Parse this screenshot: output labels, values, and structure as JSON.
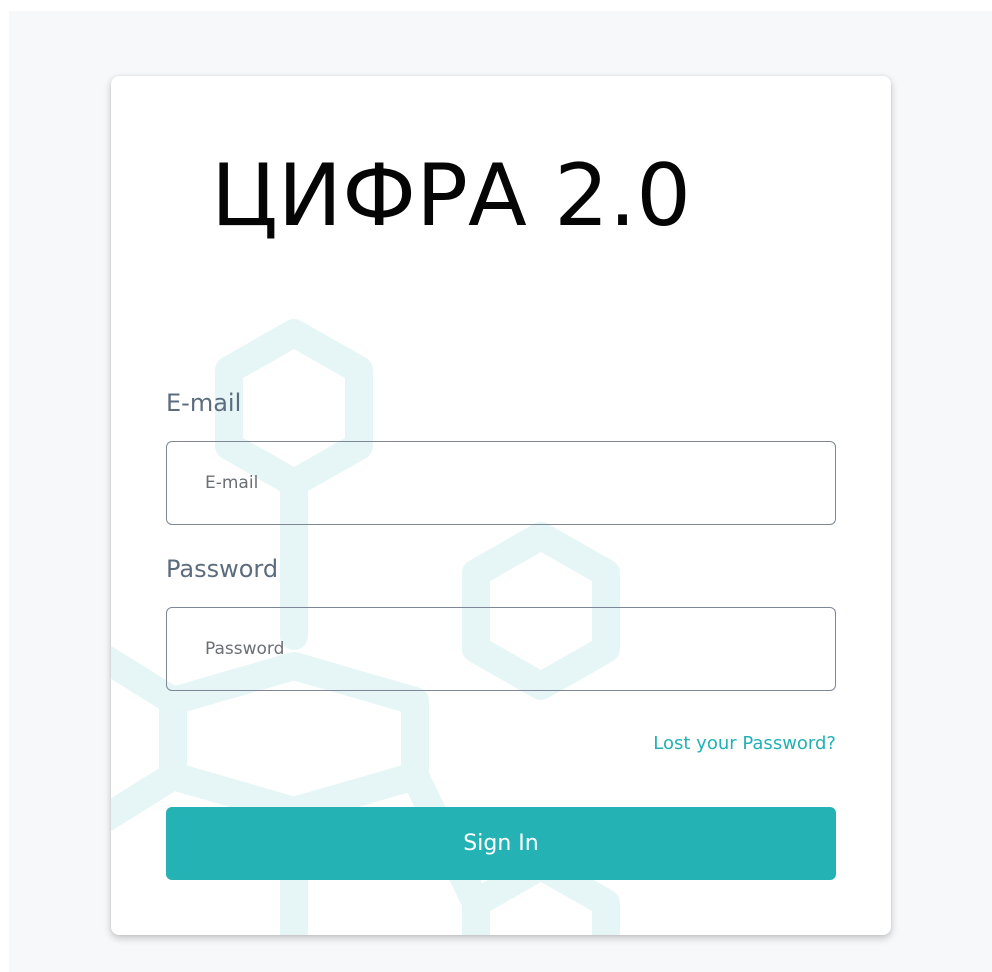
{
  "brand": {
    "logo_text": "ЦИФРА 2.0"
  },
  "login_form": {
    "email_label": "E-mail",
    "email_placeholder": "E-mail",
    "email_value": "",
    "password_label": "Password",
    "password_placeholder": "Password",
    "password_value": "",
    "lost_password_link": "Lost your Password?",
    "signin_label": "Sign In"
  },
  "theme": {
    "accent_color": "#24b2b5",
    "page_background": "#f7f8fa",
    "card_background": "#ffffff",
    "label_color": "#5c6c7f",
    "decoration_color": "#e6f6f6"
  },
  "decoration": {
    "icon": "hexagon-molecule-background"
  }
}
